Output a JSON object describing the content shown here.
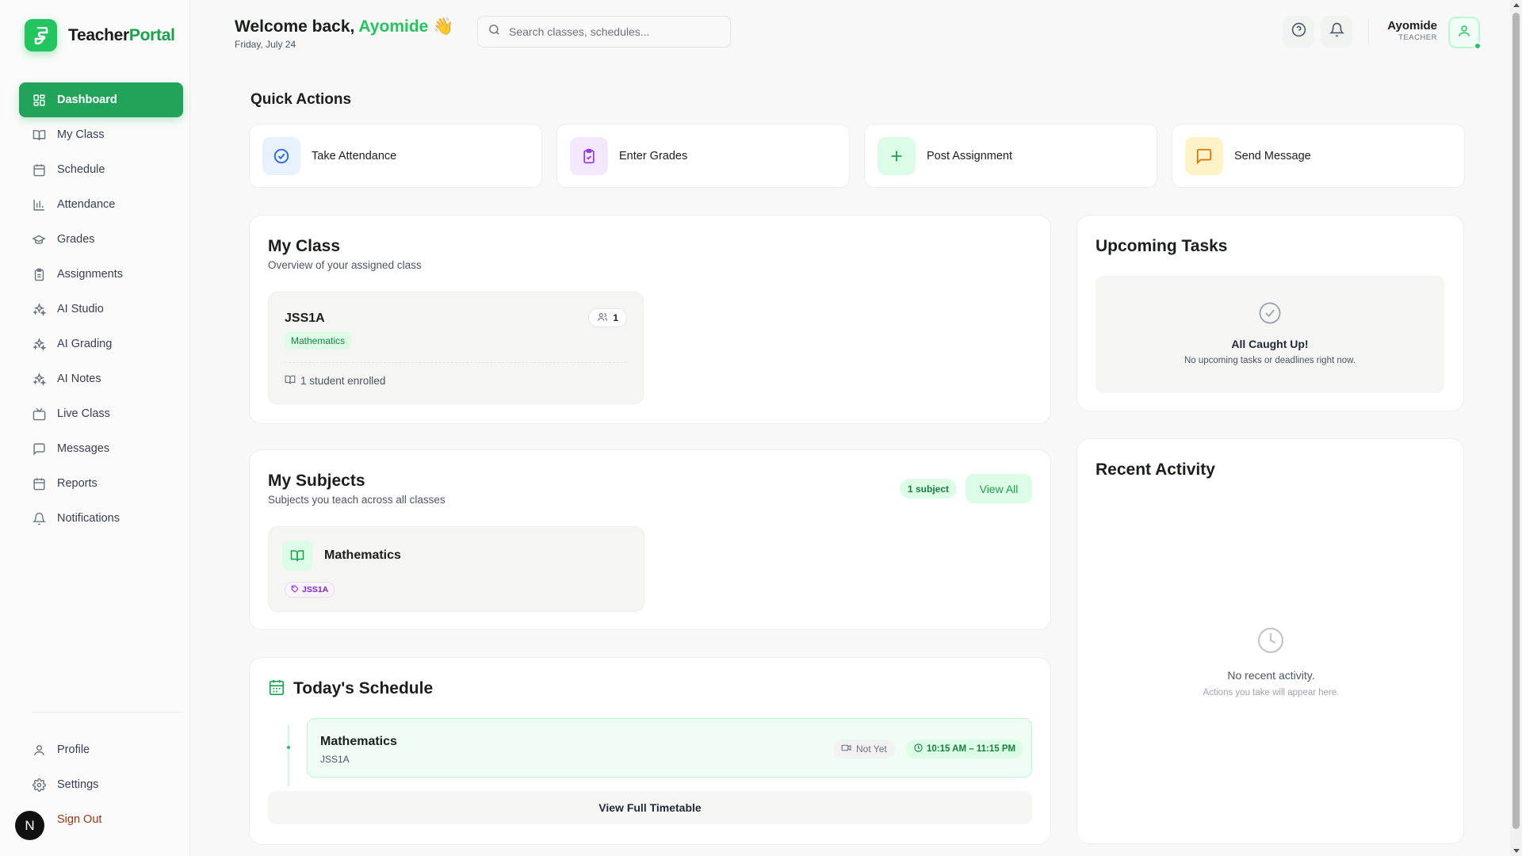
{
  "brand": {
    "name_part1": "Teacher",
    "name_part2": "Portal"
  },
  "sidebar": {
    "items": [
      {
        "label": "Dashboard",
        "icon": "grid-icon",
        "active": true
      },
      {
        "label": "My Class",
        "icon": "book-open-icon"
      },
      {
        "label": "Schedule",
        "icon": "calendar-icon"
      },
      {
        "label": "Attendance",
        "icon": "bar-chart-icon"
      },
      {
        "label": "Grades",
        "icon": "graduation-cap-icon"
      },
      {
        "label": "Assignments",
        "icon": "clipboard-icon"
      },
      {
        "label": "AI Studio",
        "icon": "sparkles-icon"
      },
      {
        "label": "AI Grading",
        "icon": "sparkles-icon"
      },
      {
        "label": "AI Notes",
        "icon": "sparkles-icon"
      },
      {
        "label": "Live Class",
        "icon": "tv-icon"
      },
      {
        "label": "Messages",
        "icon": "message-square-icon"
      },
      {
        "label": "Reports",
        "icon": "calendar-icon"
      },
      {
        "label": "Notifications",
        "icon": "bell-icon"
      }
    ],
    "bottom": [
      {
        "label": "Profile",
        "icon": "user-icon"
      },
      {
        "label": "Settings",
        "icon": "gear-icon"
      },
      {
        "label": "Sign Out",
        "icon": "log-out-icon"
      }
    ],
    "avatar_letter": "N"
  },
  "header": {
    "welcome_prefix": "Welcome back,",
    "user_first_name": "Ayomide",
    "wave": "👋",
    "date": "Friday, July 24",
    "search_placeholder": "Search classes, schedules...",
    "user_name": "Ayomide",
    "user_role": "TEACHER"
  },
  "quick_actions": {
    "title": "Quick Actions",
    "items": [
      {
        "label": "Take Attendance",
        "icon": "check-circle-icon",
        "bg": "#e8f1fe",
        "color": "#2563eb"
      },
      {
        "label": "Enter Grades",
        "icon": "clipboard-check-icon",
        "bg": "#f3e8ff",
        "color": "#9333ea"
      },
      {
        "label": "Post Assignment",
        "icon": "plus-icon",
        "bg": "#dcfce7",
        "color": "#16a34a"
      },
      {
        "label": "Send Message",
        "icon": "message-square-icon",
        "bg": "#fef3c7",
        "color": "#d97706"
      }
    ]
  },
  "my_class": {
    "title": "My Class",
    "subtitle": "Overview of your assigned class",
    "class_name": "JSS1A",
    "student_count": "1",
    "subject_tag": "Mathematics",
    "enrolled_text": "1 student enrolled"
  },
  "upcoming_tasks": {
    "title": "Upcoming Tasks",
    "empty_title": "All Caught Up!",
    "empty_sub": "No upcoming tasks or deadlines right now."
  },
  "my_subjects": {
    "title": "My Subjects",
    "subtitle": "Subjects you teach across all classes",
    "count_badge": "1 subject",
    "view_all": "View All",
    "subject_name": "Mathematics",
    "class_tag": "JSS1A"
  },
  "recent_activity": {
    "title": "Recent Activity",
    "empty_title": "No recent activity.",
    "empty_sub": "Actions you take will appear here."
  },
  "schedule": {
    "title": "Today's Schedule",
    "subject": "Mathematics",
    "class": "JSS1A",
    "status": "Not Yet",
    "time": "10:15 AM – 11:15 PM",
    "view_full": "View Full Timetable"
  },
  "colors": {
    "accent": "#22c55e",
    "accent_dark": "#16a34a",
    "signout": "#9a3412"
  }
}
